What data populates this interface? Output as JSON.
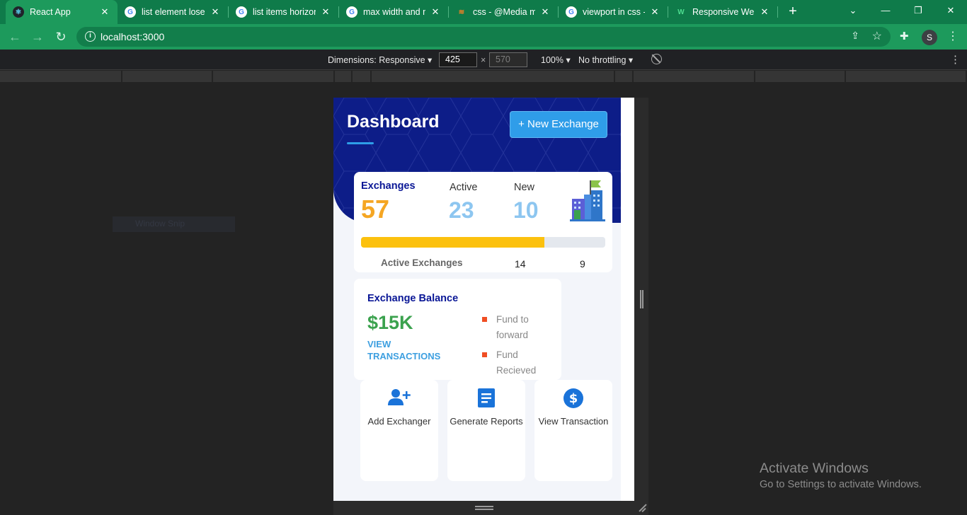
{
  "browser": {
    "tabs": [
      {
        "title": "React App",
        "favicon": "react-icon",
        "active": true
      },
      {
        "title": "list element loses",
        "favicon": "google-icon"
      },
      {
        "title": "list items horizon",
        "favicon": "google-icon"
      },
      {
        "title": "max width and m",
        "favicon": "google-icon"
      },
      {
        "title": "css - @Media mi",
        "favicon": "stackoverflow-icon"
      },
      {
        "title": "viewport in css -",
        "favicon": "google-icon"
      },
      {
        "title": "Responsive Web",
        "favicon": "w-icon"
      }
    ],
    "new_tab": "+",
    "address": "localhost:3000",
    "profile_initial": "S",
    "accent_color": "#1d9a5c"
  },
  "devtools": {
    "dimensions_label": "Dimensions: Responsive",
    "width_value": "425",
    "times": "×",
    "height_value": "570",
    "zoom": "100%",
    "throttling": "No throttling"
  },
  "ghost_text": "Window Snip",
  "app": {
    "title": "Dashboard",
    "new_exchange_button": "+ New Exchange",
    "exchanges": {
      "label": "Exchanges",
      "count": "57",
      "active_label": "Active",
      "active_count": "23",
      "new_label": "New",
      "new_count": "10",
      "progress_fraction": 0.75,
      "active_exchanges_label": "Active Exchanges",
      "active_value_1": "14",
      "active_value_2": "9"
    },
    "balance": {
      "label": "Exchange Balance",
      "amount": "$15K",
      "view_transactions": "VIEW TRANSACTIONS",
      "legend": [
        "Fund to forward",
        "Fund Recieved"
      ]
    },
    "actions": [
      {
        "label": "Add Exchanger",
        "icon": "add-user-icon"
      },
      {
        "label": "Generate Reports",
        "icon": "document-icon"
      },
      {
        "label": "View Transaction",
        "icon": "dollar-icon"
      }
    ],
    "colors": {
      "hero": "#0d1d88",
      "accent": "#2f9de9",
      "orange": "#f5a623",
      "green": "#3ba24e",
      "progress": "#fcc10e"
    }
  },
  "watermark": {
    "title": "Activate Windows",
    "subtitle": "Go to Settings to activate Windows."
  }
}
